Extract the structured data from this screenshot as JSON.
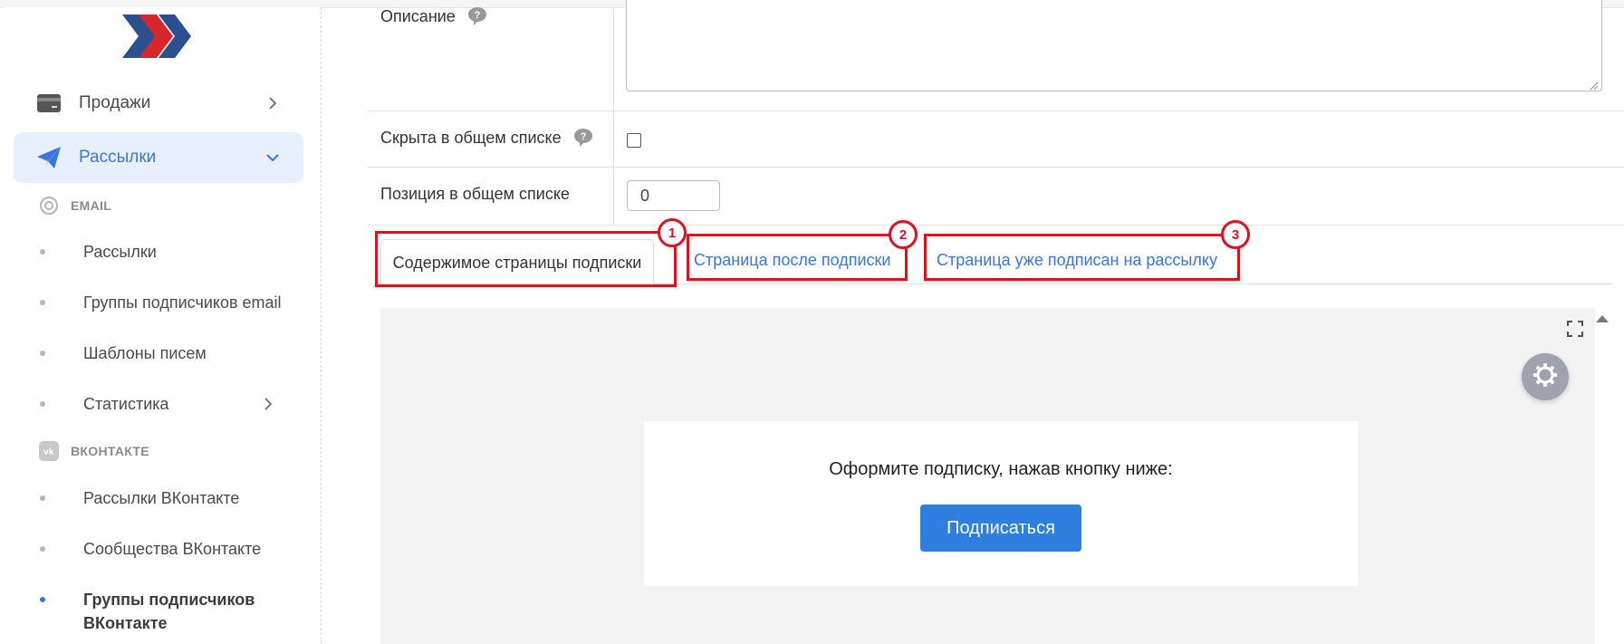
{
  "colors": {
    "accent": "#3a76db",
    "highlight": "#e0111c",
    "button": "#2e7fe0"
  },
  "sidebar": {
    "menu": [
      {
        "label": "Продажи",
        "icon": "card-icon"
      },
      {
        "label": "Рассылки",
        "icon": "paper-plane-icon"
      }
    ],
    "sections": [
      {
        "title": "EMAIL",
        "icon": "at-icon"
      },
      {
        "title": "ВКОНТАКТЕ",
        "icon": "vk-icon"
      }
    ],
    "email_items": [
      "Рассылки",
      "Группы подписчиков email",
      "Шаблоны писем",
      "Статистика"
    ],
    "vk_items": [
      "Рассылки ВКонтакте",
      "Сообщества ВКонтакте",
      "Группы подписчиков ВКонтакте"
    ]
  },
  "form": {
    "description_label": "Описание",
    "hidden_label": "Скрыта в общем списке",
    "hidden_checked": false,
    "position_label": "Позиция в общем списке",
    "position_value": "0"
  },
  "tabs": [
    {
      "label": "Содержимое страницы подписки",
      "badge": "1"
    },
    {
      "label": "Страница после подписки",
      "badge": "2"
    },
    {
      "label": "Страница уже подписан на рассылку",
      "badge": "3"
    }
  ],
  "editor": {
    "prompt_text": "Оформите подписку, нажав кнопку ниже:",
    "subscribe_button": "Подписаться"
  }
}
